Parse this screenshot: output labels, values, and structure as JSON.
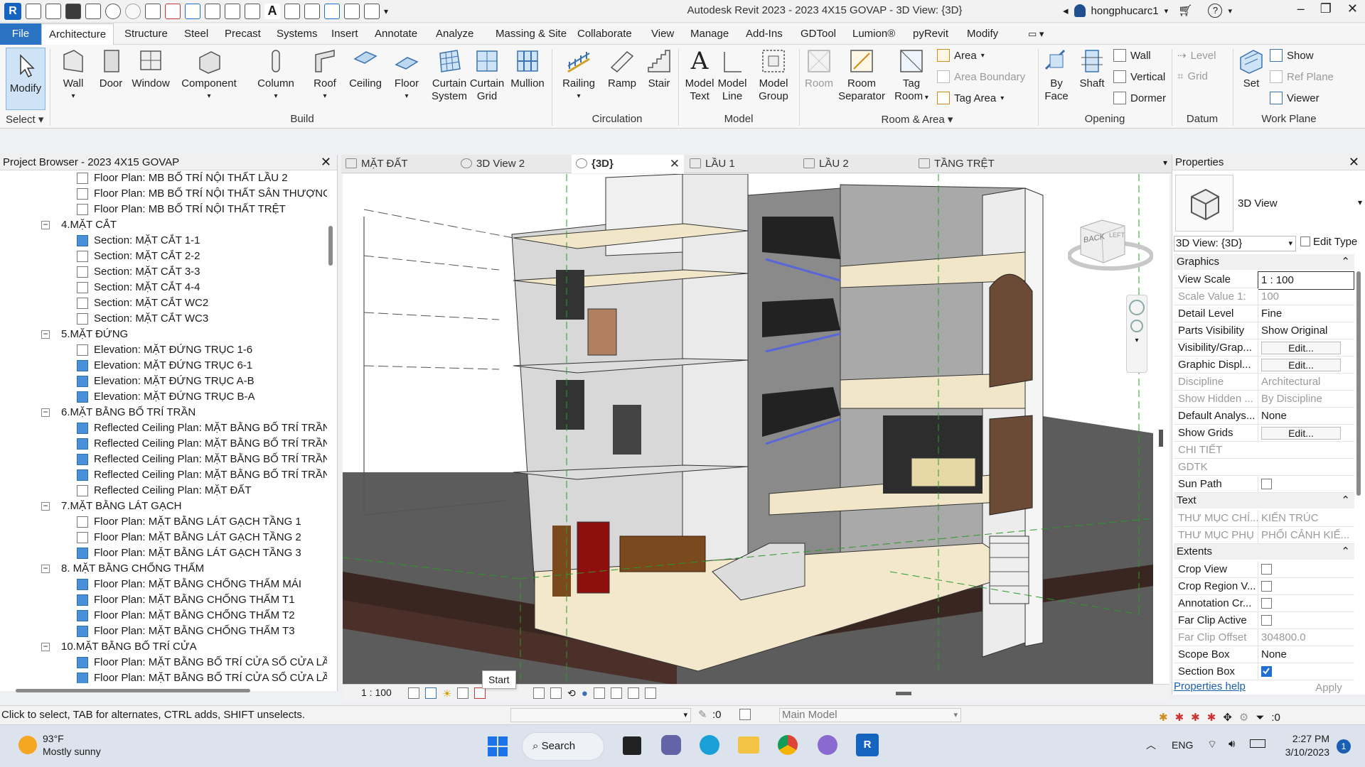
{
  "app": {
    "title": "Autodesk Revit 2023 - 2023 4X15 GOVAP - 3D View: {3D}",
    "user": "hongphucarc1",
    "logo": "R"
  },
  "menu": {
    "file": "File",
    "tabs": [
      "Architecture",
      "Structure",
      "Steel",
      "Precast",
      "Systems",
      "Insert",
      "Annotate",
      "Analyze",
      "Massing & Site",
      "Collaborate",
      "View",
      "Manage",
      "Add-Ins",
      "GDTool",
      "Lumion®",
      "pyRevit",
      "Modify"
    ]
  },
  "ribbon": {
    "select": {
      "modify": "Modify",
      "label": "Select"
    },
    "build": {
      "items": [
        "Wall",
        "Door",
        "Window",
        "Component",
        "Column",
        "Roof",
        "Ceiling",
        "Floor",
        "Curtain System",
        "Curtain Grid",
        "Mullion"
      ],
      "label": "Build"
    },
    "circulation": {
      "items": [
        "Railing",
        "Ramp",
        "Stair"
      ],
      "label": "Circulation"
    },
    "model": {
      "items": [
        "Model Text",
        "Model Line",
        "Model Group"
      ],
      "label": "Model"
    },
    "room_area": {
      "items": [
        "Room",
        "Room Separator",
        "Tag Room"
      ],
      "area": "Area",
      "area_boundary": "Area Boundary",
      "tag_area": "Tag Area",
      "label": "Room & Area"
    },
    "opening": {
      "items": [
        "By Face",
        "Shaft"
      ],
      "wall": "Wall",
      "vertical": "Vertical",
      "dormer": "Dormer",
      "label": "Opening"
    },
    "datum": {
      "level": "Level",
      "grid": "Grid",
      "label": "Datum"
    },
    "workplane": {
      "set": "Set",
      "show": "Show",
      "ref_plane": "Ref Plane",
      "viewer": "Viewer",
      "label": "Work Plane"
    }
  },
  "browser": {
    "title": "Project Browser - 2023 4X15 GOVAP",
    "rows": [
      {
        "text": "Floor Plan: MB BỐ TRÍ NỘI THẤT LẦU 2",
        "level": 2,
        "icon": "plan"
      },
      {
        "text": "Floor Plan: MB BỐ TRÍ NỘI THẤT SÂN THƯỢNG",
        "level": 2,
        "icon": "plan"
      },
      {
        "text": "Floor Plan: MB BỐ TRÍ NỘI THẤT TRỆT",
        "level": 2,
        "icon": "plan"
      },
      {
        "text": "4.MẶT CẮT",
        "level": 1,
        "icon": "folder"
      },
      {
        "text": "Section: MẶT CẮT 1-1",
        "level": 2,
        "icon": "blue"
      },
      {
        "text": "Section: MẶT CẮT 2-2",
        "level": 2,
        "icon": "plan"
      },
      {
        "text": "Section: MẶT CẮT 3-3",
        "level": 2,
        "icon": "plan"
      },
      {
        "text": "Section: MẶT CẮT 4-4",
        "level": 2,
        "icon": "plan"
      },
      {
        "text": "Section: MẶT CẮT WC2",
        "level": 2,
        "icon": "plan"
      },
      {
        "text": "Section: MẶT CẮT WC3",
        "level": 2,
        "icon": "plan"
      },
      {
        "text": "5.MẶT ĐỨNG",
        "level": 1,
        "icon": "folder"
      },
      {
        "text": "Elevation: MẶT ĐỨNG TRỤC 1-6",
        "level": 2,
        "icon": "plan"
      },
      {
        "text": "Elevation: MẶT ĐỨNG TRỤC 6-1",
        "level": 2,
        "icon": "blue"
      },
      {
        "text": "Elevation: MẶT ĐỨNG TRỤC A-B",
        "level": 2,
        "icon": "blue"
      },
      {
        "text": "Elevation: MẶT ĐỨNG TRỤC B-A",
        "level": 2,
        "icon": "blue"
      },
      {
        "text": "6.MẶT BẰNG BỐ TRÍ TRẦN",
        "level": 1,
        "icon": "folder"
      },
      {
        "text": "Reflected Ceiling Plan: MẶT BẰNG BỐ TRÍ TRẦN",
        "level": 2,
        "icon": "blue"
      },
      {
        "text": "Reflected Ceiling Plan: MẶT BẰNG BỐ TRÍ TRẦN",
        "level": 2,
        "icon": "blue"
      },
      {
        "text": "Reflected Ceiling Plan: MẶT BẰNG BỐ TRÍ TRẦN",
        "level": 2,
        "icon": "blue"
      },
      {
        "text": "Reflected Ceiling Plan: MẶT BẰNG BỐ TRÍ TRẦN",
        "level": 2,
        "icon": "blue"
      },
      {
        "text": "Reflected Ceiling Plan: MẶT ĐẤT",
        "level": 2,
        "icon": "plan"
      },
      {
        "text": "7.MẶT BẰNG LÁT GẠCH",
        "level": 1,
        "icon": "folder"
      },
      {
        "text": "Floor Plan: MẶT BẰNG LÁT GẠCH TẦNG 1",
        "level": 2,
        "icon": "plan"
      },
      {
        "text": "Floor Plan: MẶT BẰNG LÁT GẠCH TẦNG 2",
        "level": 2,
        "icon": "plan"
      },
      {
        "text": "Floor Plan: MẶT BẰNG LÁT GẠCH TẦNG 3",
        "level": 2,
        "icon": "blue"
      },
      {
        "text": "8. MẶT BẰNG CHỐNG THẤM",
        "level": 1,
        "icon": "folder"
      },
      {
        "text": "Floor Plan: MẶT BẰNG CHỐNG THẤM MÁI",
        "level": 2,
        "icon": "blue"
      },
      {
        "text": "Floor Plan: MẶT BẰNG CHỐNG THẤM T1",
        "level": 2,
        "icon": "blue"
      },
      {
        "text": "Floor Plan: MẶT BẰNG CHỐNG THẤM T2",
        "level": 2,
        "icon": "blue"
      },
      {
        "text": "Floor Plan: MẶT BẰNG CHỐNG THẤM T3",
        "level": 2,
        "icon": "blue"
      },
      {
        "text": "10.MẶT BẰNG BỐ TRÍ CỬA",
        "level": 1,
        "icon": "folder"
      },
      {
        "text": "Floor Plan: MẶT BẰNG BỐ TRÍ CỬA SỔ CỬA LẦU",
        "level": 2,
        "icon": "blue"
      },
      {
        "text": "Floor Plan: MẶT BẰNG BỐ TRÍ CỬA SỔ CỬA LẦU",
        "level": 2,
        "icon": "blue"
      }
    ]
  },
  "viewtabs": [
    {
      "label": "MẶT ĐẤT",
      "active": false
    },
    {
      "label": "3D View 2",
      "active": false
    },
    {
      "label": "{3D}",
      "active": true
    },
    {
      "label": "LẦU 1",
      "active": false
    },
    {
      "label": "LẦU 2",
      "active": false
    },
    {
      "label": "TẦNG TRỆT",
      "active": false
    }
  ],
  "viewcube": {
    "back": "BACK",
    "left": "LEFT"
  },
  "viewbar": {
    "scale": "1 : 100",
    "tooltip": "Start"
  },
  "properties": {
    "title": "Properties",
    "type_name": "3D View",
    "selector": "3D View: {3D}",
    "edit_type": "Edit Type",
    "sections": {
      "graphics": "Graphics",
      "text": "Text",
      "extents": "Extents"
    },
    "graphics": [
      {
        "k": "View Scale",
        "v": "1 : 100",
        "type": "input"
      },
      {
        "k": "Scale Value    1:",
        "v": "100",
        "type": "dim"
      },
      {
        "k": "Detail Level",
        "v": "Fine",
        "type": "text"
      },
      {
        "k": "Parts Visibility",
        "v": "Show Original",
        "type": "text"
      },
      {
        "k": "Visibility/Grap...",
        "v": "Edit...",
        "type": "button"
      },
      {
        "k": "Graphic Displ...",
        "v": "Edit...",
        "type": "button"
      },
      {
        "k": "Discipline",
        "v": "Architectural",
        "type": "dim"
      },
      {
        "k": "Show Hidden ...",
        "v": "By Discipline",
        "type": "dim"
      },
      {
        "k": "Default Analys...",
        "v": "None",
        "type": "text"
      },
      {
        "k": "Show Grids",
        "v": "Edit...",
        "type": "button"
      },
      {
        "k": "CHI TIẾT",
        "v": "",
        "type": "dim"
      },
      {
        "k": "GDTK",
        "v": "",
        "type": "dim"
      },
      {
        "k": "Sun Path",
        "v": "",
        "type": "check",
        "checked": false
      }
    ],
    "text": [
      {
        "k": "THƯ MỤC CHÍ...",
        "v": "KIẾN TRÚC",
        "type": "dim"
      },
      {
        "k": "THƯ MỤC PHỤ",
        "v": "PHỐI CẢNH KIẾ...",
        "type": "dim"
      }
    ],
    "extents": [
      {
        "k": "Crop View",
        "v": "",
        "type": "check",
        "checked": false
      },
      {
        "k": "Crop Region V...",
        "v": "",
        "type": "check",
        "checked": false
      },
      {
        "k": "Annotation Cr...",
        "v": "",
        "type": "check",
        "checked": false
      },
      {
        "k": "Far Clip Active",
        "v": "",
        "type": "check",
        "checked": false
      },
      {
        "k": "Far Clip Offset",
        "v": "304800.0",
        "type": "dim"
      },
      {
        "k": "Scope Box",
        "v": "None",
        "type": "text"
      },
      {
        "k": "Section Box",
        "v": "",
        "type": "check",
        "checked": true
      }
    ],
    "help": "Properties help",
    "apply": "Apply"
  },
  "status": {
    "hint": "Click to select, TAB for alternates, CTRL adds, SHIFT unselects.",
    "zero": ":0",
    "model": "Main Model",
    "filter": ":0"
  },
  "taskbar": {
    "temp": "93°F",
    "weather": "Mostly sunny",
    "search": "Search",
    "lang": "ENG",
    "time": "2:27 PM",
    "date": "3/10/2023",
    "badge": "1"
  }
}
